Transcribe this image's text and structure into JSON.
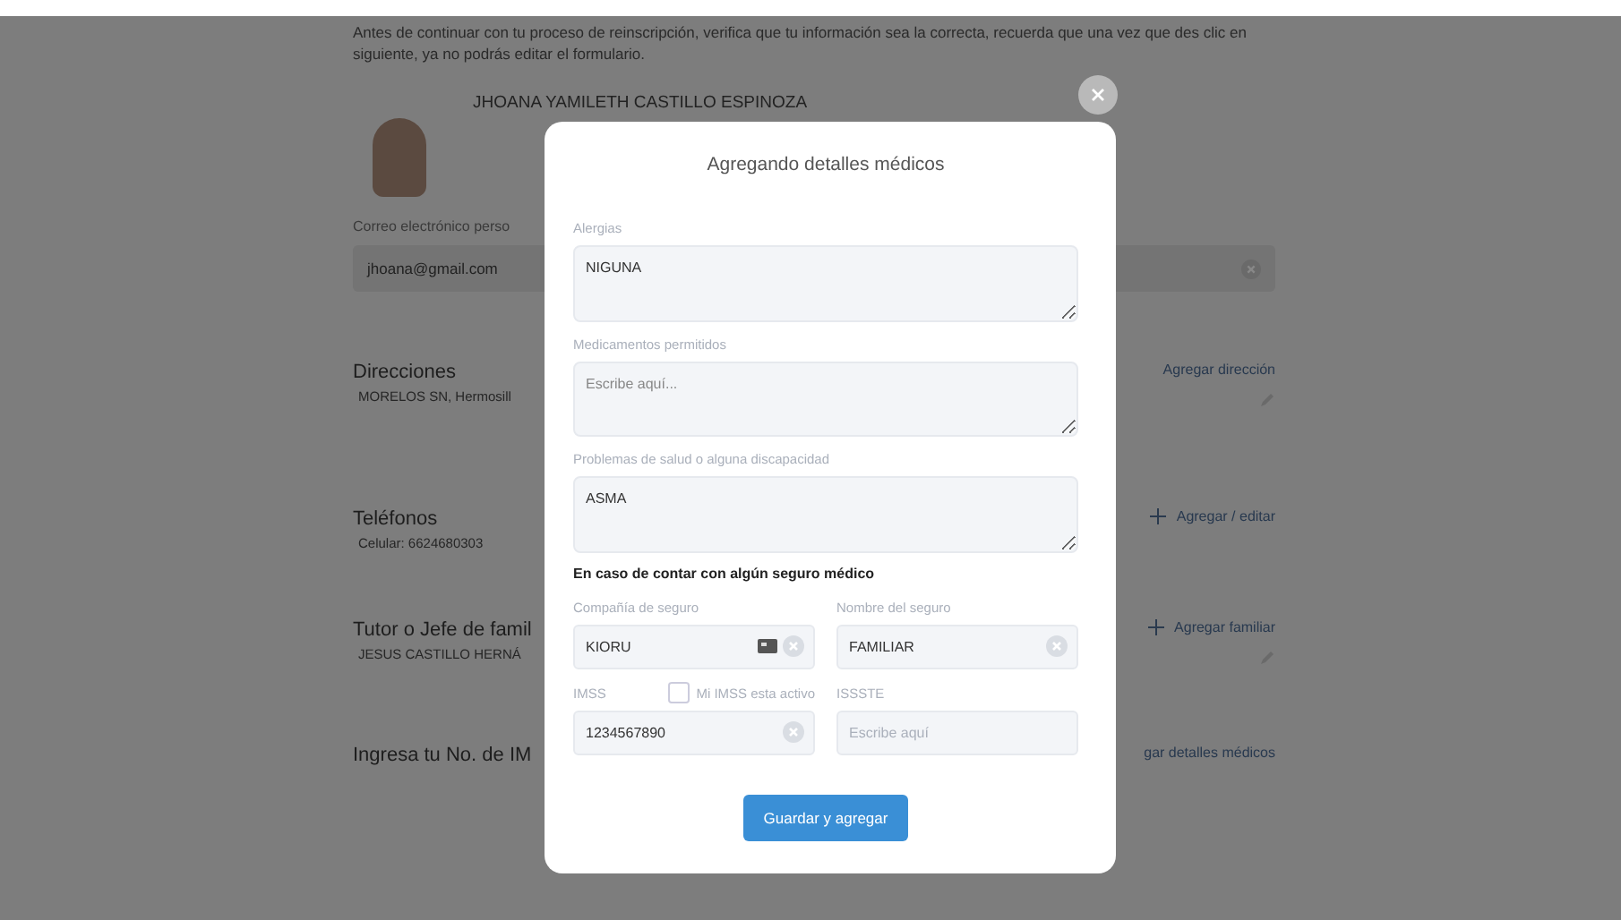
{
  "background_page": {
    "intro": "Antes de continuar con tu proceso de reinscripción, verifica que tu información sea la correcta, recuerda que una vez que des clic en siguiente, ya no podrás editar el formulario.",
    "student_name": "JHOANA YAMILETH CASTILLO ESPINOZA",
    "email_label": "Correo electrónico perso",
    "email_value": "jhoana@gmail.com",
    "sections": [
      {
        "title": "Direcciones",
        "detail": "MORELOS SN, Hermosill",
        "action": "Agregar dirección",
        "plus": false,
        "pencil": true
      },
      {
        "title": "Teléfonos",
        "detail": "Celular: 6624680303",
        "action": "Agregar / editar",
        "plus": true,
        "pencil": false
      },
      {
        "title": "Tutor o Jefe de famil",
        "detail": "JESUS CASTILLO HERNÁ",
        "action": "Agregar familiar",
        "plus": true,
        "pencil": true
      },
      {
        "title": "Ingresa tu No. de IM",
        "action": "gar detalles médicos",
        "plus": false,
        "pencil": false
      }
    ]
  },
  "modal": {
    "title": "Agregando detalles médicos",
    "text_areas": [
      {
        "label": "Alergias",
        "value": "NIGUNA"
      },
      {
        "label": "Medicamentos permitidos",
        "placeholder": "Escribe aquí..."
      },
      {
        "label": "Problemas de salud o alguna discapacidad",
        "value": "ASMA"
      }
    ],
    "insurance_heading": "En caso de contar con algún seguro médico",
    "insurance_fields": [
      {
        "label": "Compañía de seguro",
        "value": "KIORU",
        "card_icon": true,
        "clearable": true
      },
      {
        "label": "Nombre del seguro",
        "value": "FAMILIAR",
        "clearable": true
      },
      {
        "label": "IMSS",
        "value": "1234567890",
        "clearable": true,
        "checkbox": {
          "label": "Mi IMSS esta activo",
          "checked": false
        }
      },
      {
        "label": "ISSSTE",
        "placeholder": "Escribe aquí"
      }
    ],
    "submit": "Guardar y agregar"
  }
}
